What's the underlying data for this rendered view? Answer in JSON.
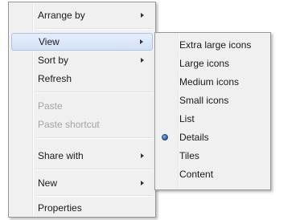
{
  "context_menu": {
    "items": [
      {
        "label": "Arrange by"
      },
      {
        "label": "View"
      },
      {
        "label": "Sort by"
      },
      {
        "label": "Refresh"
      },
      {
        "label": "Paste"
      },
      {
        "label": "Paste shortcut"
      },
      {
        "label": "Share with"
      },
      {
        "label": "New"
      },
      {
        "label": "Properties"
      }
    ]
  },
  "view_submenu": {
    "items": [
      {
        "label": "Extra large icons"
      },
      {
        "label": "Large icons"
      },
      {
        "label": "Medium icons"
      },
      {
        "label": "Small icons"
      },
      {
        "label": "List"
      },
      {
        "label": "Details",
        "selected": true
      },
      {
        "label": "Tiles"
      },
      {
        "label": "Content"
      }
    ]
  },
  "colors": {
    "menu_background": "#f0f0f0",
    "highlight": "#d3e1f6",
    "disabled_text": "#a3a3a3"
  }
}
